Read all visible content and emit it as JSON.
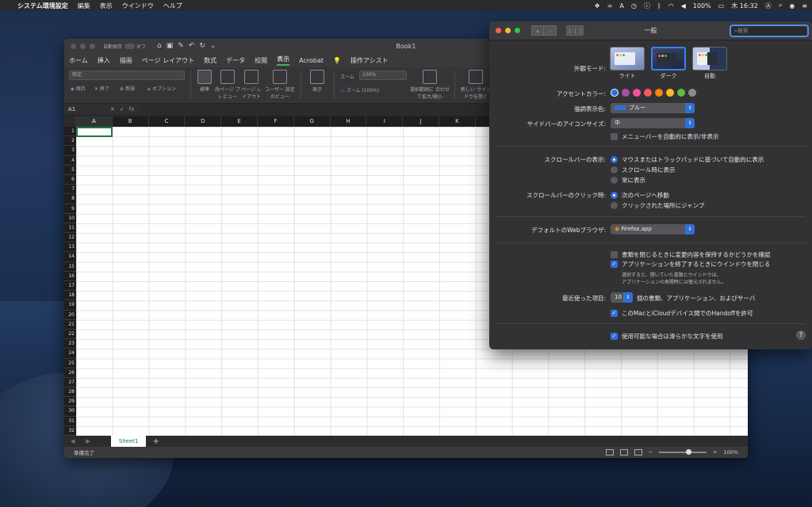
{
  "menubar": {
    "apple": "",
    "items": [
      "システム環境設定",
      "編集",
      "表示",
      "ウインドウ",
      "ヘルプ"
    ],
    "status": {
      "battery": "100%",
      "clock": "木 16:32"
    }
  },
  "excel": {
    "autosave": "自動保存",
    "autosave_state": "オフ",
    "doc_title": "Book1",
    "tabs": [
      "ホーム",
      "挿入",
      "描画",
      "ページ レイアウト",
      "数式",
      "データ",
      "校閲",
      "表示",
      "Acrobat"
    ],
    "active_tab_index": 7,
    "tell_me": "操作アシスト",
    "ribbon": {
      "sheet_view_placeholder": "既定",
      "keep": "保持",
      "exit": "終了",
      "new": "新規",
      "options": "オプション",
      "normal": "標準",
      "page_break": "改ページ プレビュー",
      "page_layout": "ページ レイアウト",
      "custom_views": "ユーザー 設定のビュー",
      "show": "表示",
      "zoom_label": "ズーム",
      "zoom_value": "100%",
      "zoom_100": "ズーム (100%)",
      "zoom_selection": "選択範囲に 合わせて拡大/縮小",
      "new_window": "新しい ウインドウを開く"
    },
    "name_box": "A1",
    "fx": "fx",
    "columns": [
      "A",
      "B",
      "C",
      "D",
      "E",
      "F",
      "G",
      "H",
      "I",
      "J",
      "K",
      "L",
      "M",
      "N",
      "O",
      "P",
      "Q",
      "R"
    ],
    "rows": [
      "1",
      "2",
      "3",
      "4",
      "5",
      "6",
      "7",
      "8",
      "9",
      "10",
      "11",
      "12",
      "13",
      "14",
      "15",
      "16",
      "17",
      "18",
      "19",
      "20",
      "21",
      "22",
      "23",
      "24",
      "25",
      "26",
      "27",
      "28",
      "29",
      "30",
      "31",
      "32"
    ],
    "sheet_tab": "Sheet1",
    "add_sheet": "+",
    "status_text": "準備完了",
    "zoom_percent": "100%"
  },
  "prefs": {
    "title": "一般",
    "search_placeholder": "検索",
    "appearance_label": "外観モード:",
    "appearance_options": [
      "ライト",
      "ダーク",
      "自動"
    ],
    "appearance_selected": "ダーク",
    "accent_label": "アクセントカラー:",
    "accent_colors": [
      "#2f6fd8",
      "#a550a7",
      "#f74f9e",
      "#fc5753",
      "#fd8208",
      "#fdb826",
      "#62ba46",
      "#8c8c8c"
    ],
    "highlight_label": "強調表示色:",
    "highlight_value": "ブルー",
    "highlight_swatch": "#2f6fd8",
    "sidebar_icon_label": "サイドバーのアイコンサイズ:",
    "sidebar_icon_value": "中",
    "menubar_autohide": "メニューバーを自動的に表示/非表示",
    "scrollbar_label": "スクロールバーの表示:",
    "scrollbar_options": [
      "マウスまたはトラックパッドに基づいて自動的に表示",
      "スクロール時に表示",
      "常に表示"
    ],
    "scrollclick_label": "スクロールバーのクリック時:",
    "scrollclick_options": [
      "次のページへ移動",
      "クリックされた場所にジャンプ"
    ],
    "browser_label": "デフォルトのWebブラウザ:",
    "browser_value": "Firefox.app",
    "ask_keep_changes": "書類を閉じるときに変更内容を保持するかどうかを確認",
    "close_windows": "アプリケーションを終了するときにウインドウを閉じる",
    "close_windows_note_1": "選択すると、開いていた書類とウインドウは、",
    "close_windows_note_2": "アプリケーションの再開時には復元されません。",
    "recent_label": "最近使った項目:",
    "recent_value": "10",
    "recent_suffix": "個の書類、アプリケーション、およびサーバ",
    "handoff": "このMacとiCloudデバイス間でのHandoffを許可",
    "font_smoothing": "使用可能な場合は滑らかな文字を使用",
    "help": "?"
  }
}
